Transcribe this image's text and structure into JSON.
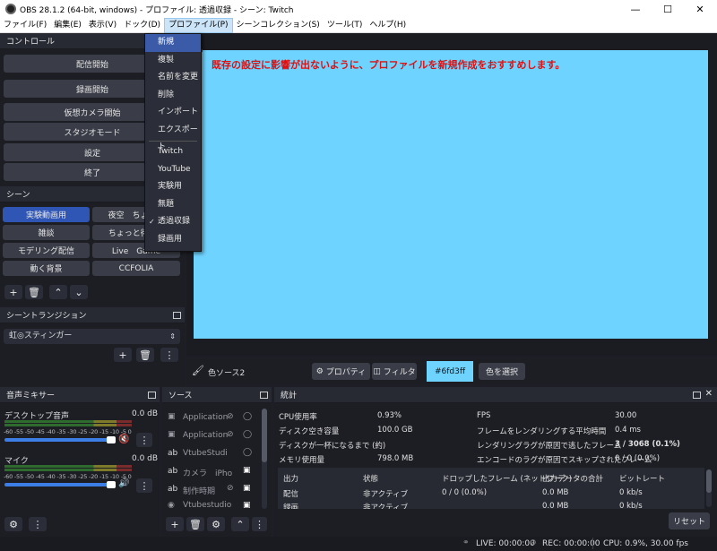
{
  "window": {
    "title": "OBS 28.1.2 (64-bit, windows) - プロファイル: 透過収録 - シーン: Twitch"
  },
  "menubar": [
    "ファイル(F)",
    "編集(E)",
    "表示(V)",
    "ドック(D)",
    "プロファイル(P)",
    "シーンコレクション(S)",
    "ツール(T)",
    "ヘルプ(H)"
  ],
  "profile_menu": {
    "items": [
      "新規",
      "複製",
      "名前を変更",
      "削除",
      "インポート",
      "エクスポート"
    ],
    "profiles": [
      "Twitch",
      "YouTube",
      "実験用",
      "無題",
      "透過収録",
      "録画用"
    ],
    "checked": "透過収録"
  },
  "controls": {
    "title": "コントロール",
    "buttons": [
      "配信開始",
      "録画開始",
      "仮想カメラ開始",
      "スタジオモード",
      "設定",
      "終了"
    ]
  },
  "scenes": {
    "title": "シーン",
    "items": [
      "実験動画用",
      "夜空　ちょっと",
      "雑談",
      "ちょっと待って",
      "モデリング配信",
      "Live　Game",
      "動く背景",
      "CCFOLIA"
    ]
  },
  "transitions": {
    "title": "シーントランジション",
    "selected": "虹◎スティンガー"
  },
  "annotation": "既存の設定に影響が出ないように、プロファイルを新規作成をおすすめします。",
  "preview_color": "#6fd3ff",
  "source_bar": {
    "source_name": "色ソース2",
    "properties": "プロパティ",
    "filters": "フィルタ",
    "color_value": "#6fd3ff",
    "select_color": "色を選択"
  },
  "mixer": {
    "title": "音声ミキサー",
    "channels": [
      {
        "name": "デスクトップ音声",
        "level": "0.0 dB"
      },
      {
        "name": "マイク",
        "level": "0.0 dB"
      }
    ],
    "scale": "-60 -55 -50 -45 -40 -35 -30 -25 -20 -15 -10 -5 0"
  },
  "sources": {
    "title": "ソース",
    "items": [
      {
        "type": "",
        "name": "Application"
      },
      {
        "type": "",
        "name": "Application"
      },
      {
        "type": "ab",
        "name": "VtubeStudi"
      },
      {
        "type": "ab",
        "name": "カメラ　iPho"
      },
      {
        "type": "ab",
        "name": "制作時期"
      },
      {
        "type": "",
        "name": "Vtubestudio"
      }
    ]
  },
  "stats": {
    "title": "統計",
    "left": [
      {
        "label": "CPU使用率",
        "value": "0.93%"
      },
      {
        "label": "ディスク空き容量",
        "value": "100.0 GB"
      },
      {
        "label": "ディスクが一杯になるまで (約)",
        "value": ""
      },
      {
        "label": "メモリ使用量",
        "value": "798.0 MB"
      }
    ],
    "right": [
      {
        "label": "FPS",
        "value": "30.00"
      },
      {
        "label": "フレームをレンダリングする平均時間",
        "value": "0.4 ms"
      },
      {
        "label": "レンダリングラグが原因で逃したフレーム",
        "value": "3 / 3068 (0.1%)"
      },
      {
        "label": "エンコードのラグが原因でスキップされたフレーム",
        "value": "0 / 0 (0.0%)"
      }
    ],
    "table_headers": [
      "出力",
      "状態",
      "ドロップしたフレーム (ネットワーク)",
      "出力データの合計",
      "ビットレート"
    ],
    "rows": [
      [
        "配信",
        "非アクティブ",
        "0 / 0 (0.0%)",
        "0.0 MB",
        "0 kb/s"
      ],
      [
        "録画",
        "非アクティブ",
        "",
        "0.0 MB",
        "0 kb/s"
      ]
    ],
    "reset": "リセット"
  },
  "status": {
    "live": "LIVE: 00:00:00",
    "rec": "REC: 00:00:00",
    "cpu": "CPU: 0.9%, 30.00 fps"
  }
}
